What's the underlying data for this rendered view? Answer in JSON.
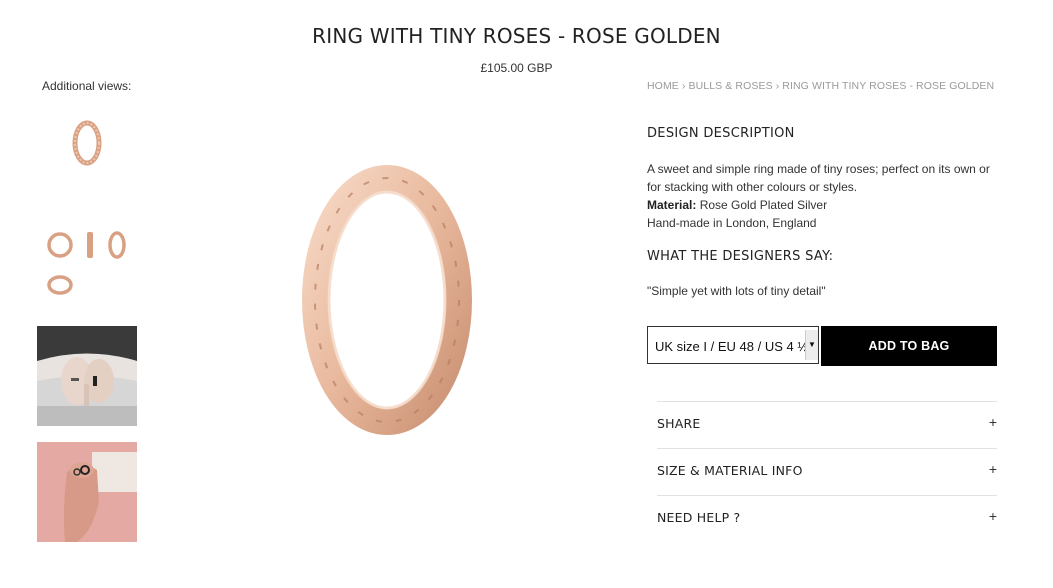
{
  "product": {
    "title": "RING WITH TINY ROSES - ROSE GOLDEN",
    "price": "£105.00 GBP"
  },
  "gallery": {
    "label": "Additional views:",
    "thumbnails": [
      "ring-single-thumb",
      "ring-multi-thumb",
      "hands-photo-thumb",
      "hand-pink-thumb"
    ]
  },
  "breadcrumb": [
    "HOME",
    "BULLS & ROSES",
    "RING WITH TINY ROSES - ROSE GOLDEN"
  ],
  "description": {
    "heading": "DESIGN DESCRIPTION",
    "line1": "A sweet and simple ring made of tiny roses; perfect on its own or for stacking with other colours or styles.",
    "material_label": "Material:",
    "material_value": "Rose Gold Plated Silver",
    "made_in": "Hand-made in London, England"
  },
  "designers": {
    "heading": "WHAT THE DESIGNERS SAY:",
    "quote": "\"Simple yet with lots of tiny detail\""
  },
  "purchase": {
    "size_value": "UK size I / EU 48 / US 4 ½",
    "add_label": "ADD TO BAG"
  },
  "accordion": [
    {
      "label": "SHARE",
      "icon": "+"
    },
    {
      "label": "SIZE & MATERIAL INFO",
      "icon": "+"
    },
    {
      "label": "NEED HELP ?",
      "icon": "+"
    }
  ],
  "colors": {
    "rose_gold": "#e8b89c",
    "rose_gold_dark": "#c98f72",
    "pink_bg": "#e5a9a3",
    "button_bg": "#000000"
  }
}
